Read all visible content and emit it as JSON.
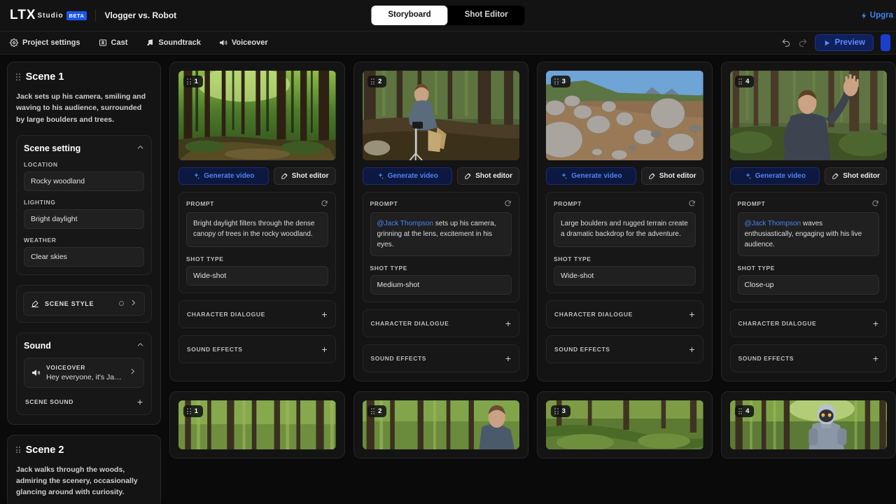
{
  "header": {
    "logo_ltx": "LTX",
    "logo_studio": "Studio",
    "beta_badge": "BETA",
    "project_title": "Vlogger vs. Robot",
    "tabs": [
      {
        "label": "Storyboard",
        "active": true
      },
      {
        "label": "Shot Editor",
        "active": false
      }
    ],
    "upgrade_label": "Upgra",
    "upgrade_icon": "bolt-icon"
  },
  "toolbar": {
    "items": [
      {
        "label": "Project settings",
        "icon": "gear-icon"
      },
      {
        "label": "Cast",
        "icon": "person-card-icon"
      },
      {
        "label": "Soundtrack",
        "icon": "music-note-icon"
      },
      {
        "label": "Voiceover",
        "icon": "megaphone-icon"
      }
    ],
    "undo_icon": "undo-icon",
    "redo_icon": "redo-icon",
    "preview_label": "Preview",
    "preview_icon": "play-icon"
  },
  "colors": {
    "accent_blue": "#4d82f5",
    "brand_blue": "#1a56f0",
    "page_bg": "#0a0a0a",
    "panel_bg": "#141414",
    "card_bg": "#171717",
    "field_bg": "#202020"
  },
  "scenes": [
    {
      "title": "Scene 1",
      "description": "Jack sets up his camera, smiling and waving to his audience, surrounded by large boulders and trees.",
      "scene_setting": {
        "title": "Scene setting",
        "collapse_icon": "chevron-up-icon",
        "fields": [
          {
            "label": "LOCATION",
            "value": "Rocky woodland"
          },
          {
            "label": "LIGHTING",
            "value": "Bright daylight"
          },
          {
            "label": "WEATHER",
            "value": "Clear skies"
          }
        ]
      },
      "scene_style": {
        "label": "SCENE STYLE",
        "icon": "brush-icon",
        "chevron": "chevron-right-icon"
      },
      "sound": {
        "title": "Sound",
        "collapse_icon": "chevron-up-icon",
        "voiceover": {
          "label": "VOICEOVER",
          "text": "Hey everyone, it's Jack her...",
          "icon": "megaphone-icon",
          "chevron": "chevron-right-icon"
        },
        "scene_sound_label": "SCENE SOUND",
        "add_icon": "plus-icon"
      },
      "shots": [
        {
          "number": "1",
          "image": "forest-path-sunlight",
          "generate_label": "Generate video",
          "generate_icon": "sparkle-icon",
          "shot_editor_label": "Shot editor",
          "shot_editor_icon": "pencil-square-icon",
          "prompt_label": "PROMPT",
          "refresh_icon": "refresh-icon",
          "prompt_mention": "",
          "prompt_text": "Bright daylight filters through the dense canopy of trees in the rocky woodland.",
          "shot_type_label": "SHOT TYPE",
          "shot_type_value": "Wide-shot",
          "character_dialogue_label": "CHARACTER DIALOGUE",
          "sound_effects_label": "SOUND EFFECTS",
          "add_icon": "plus-icon"
        },
        {
          "number": "2",
          "image": "man-crouching-camera-tripod",
          "generate_label": "Generate video",
          "generate_icon": "sparkle-icon",
          "shot_editor_label": "Shot editor",
          "shot_editor_icon": "pencil-square-icon",
          "prompt_label": "PROMPT",
          "refresh_icon": "refresh-icon",
          "prompt_mention": "@Jack Thompson",
          "prompt_text": " sets up his camera, grinning at the lens, excitement in his eyes.",
          "shot_type_label": "SHOT TYPE",
          "shot_type_value": "Medium-shot",
          "character_dialogue_label": "CHARACTER DIALOGUE",
          "sound_effects_label": "SOUND EFFECTS",
          "add_icon": "plus-icon"
        },
        {
          "number": "3",
          "image": "rocky-boulder-field-mountains",
          "generate_label": "Generate video",
          "generate_icon": "sparkle-icon",
          "shot_editor_label": "Shot editor",
          "shot_editor_icon": "pencil-square-icon",
          "prompt_label": "PROMPT",
          "refresh_icon": "refresh-icon",
          "prompt_mention": "",
          "prompt_text": "Large boulders and rugged terrain create a dramatic backdrop for the adventure.",
          "shot_type_label": "SHOT TYPE",
          "shot_type_value": "Wide-shot",
          "character_dialogue_label": "CHARACTER DIALOGUE",
          "sound_effects_label": "SOUND EFFECTS",
          "add_icon": "plus-icon"
        },
        {
          "number": "4",
          "image": "man-waving-in-forest",
          "generate_label": "Generate video",
          "generate_icon": "sparkle-icon",
          "shot_editor_label": "Shot editor",
          "shot_editor_icon": "pencil-square-icon",
          "prompt_label": "PROMPT",
          "refresh_icon": "refresh-icon",
          "prompt_mention": "@Jack Thompson",
          "prompt_text": " waves enthusiastically, engaging with his live audience.",
          "shot_type_label": "SHOT TYPE",
          "shot_type_value": "Close-up",
          "character_dialogue_label": "CHARACTER DIALOGUE",
          "sound_effects_label": "SOUND EFFECTS",
          "add_icon": "plus-icon"
        }
      ]
    },
    {
      "title": "Scene 2",
      "description": "Jack walks through the woods, admiring the scenery, occasionally glancing around with curiosity.",
      "shots": [
        {
          "number": "1",
          "image": "tall-forest-trees"
        },
        {
          "number": "2",
          "image": "man-walking-forest"
        },
        {
          "number": "3",
          "image": "mossy-forest-floor"
        },
        {
          "number": "4",
          "image": "robot-in-forest"
        }
      ]
    }
  ]
}
